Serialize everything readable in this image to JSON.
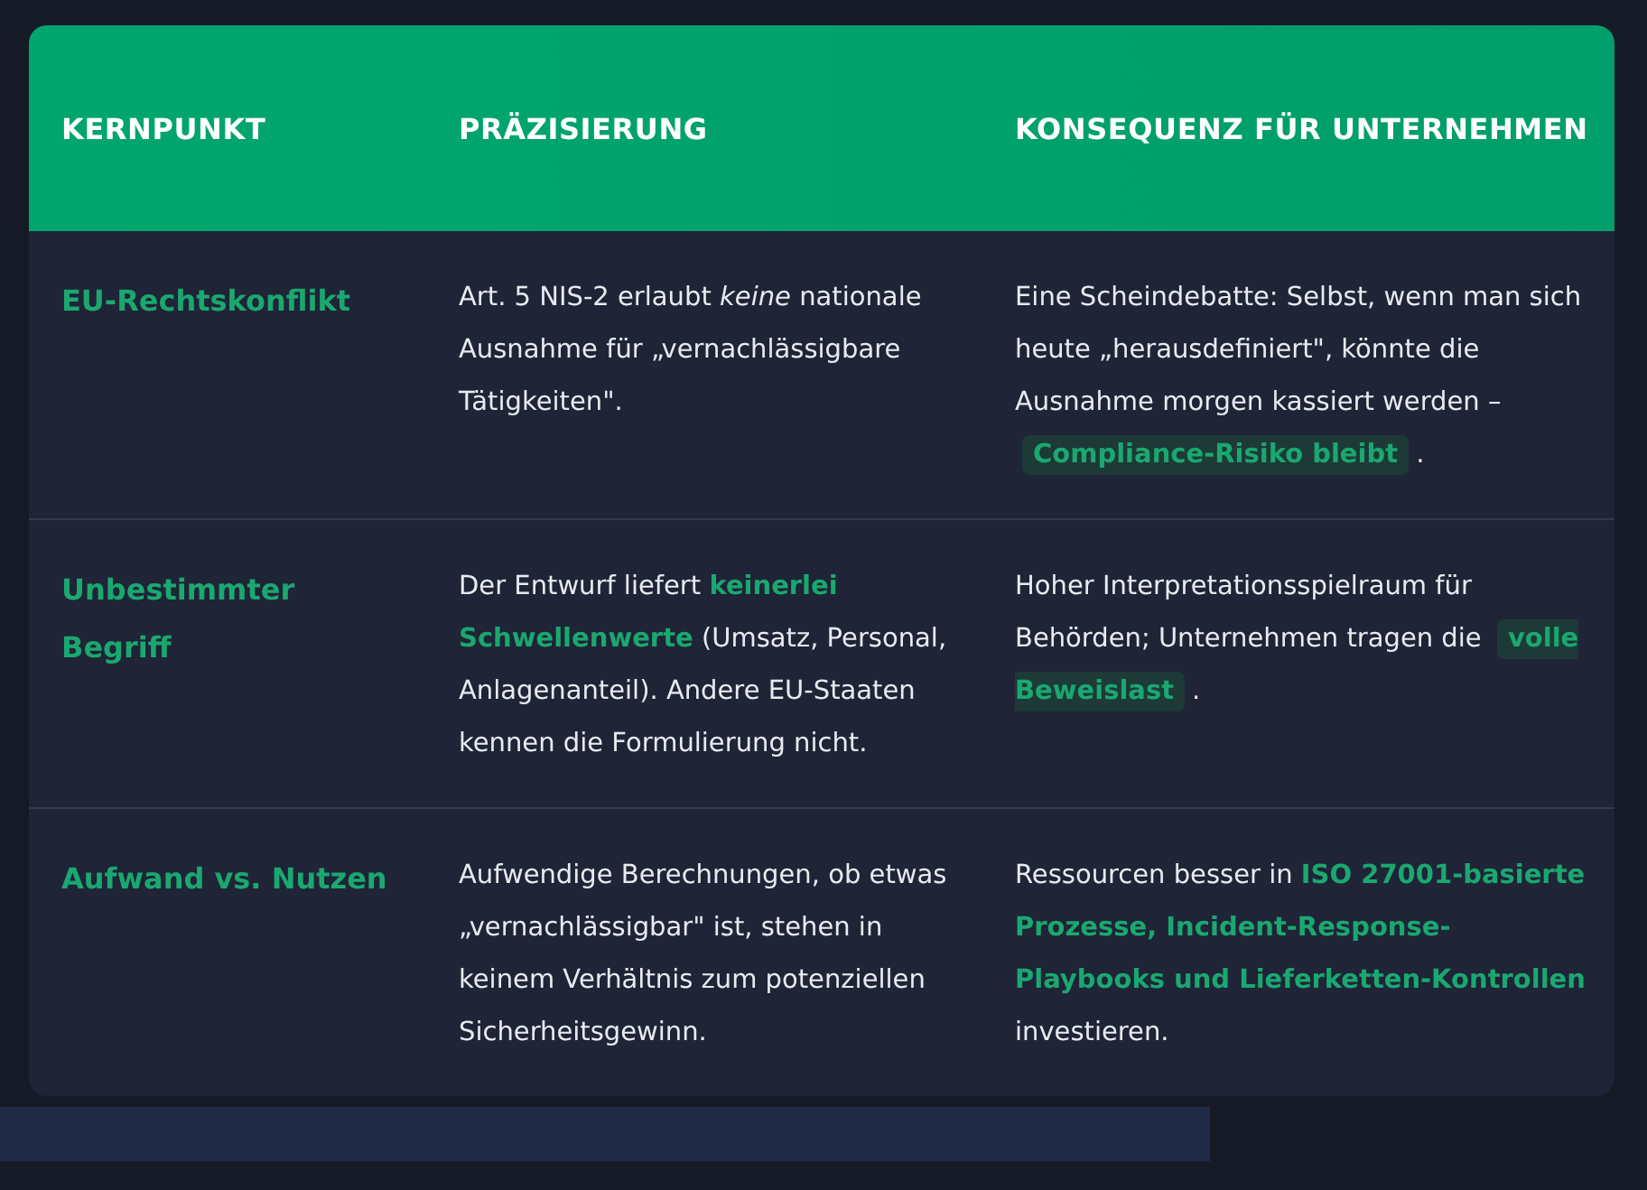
{
  "table": {
    "columns": [
      "KERNPUNKT",
      "PRÄZISIERUNG",
      "KONSEQUENZ FÜR UNTERNEHMEN"
    ],
    "rows": [
      {
        "key": "EU-Rechtskonflikt",
        "detail": [
          {
            "kind": "plain",
            "text": "Art. 5 NIS-2 erlaubt "
          },
          {
            "kind": "em",
            "text": "keine"
          },
          {
            "kind": "plain",
            "text": " nationale Ausnahme für „vernachlässigbare Tätigkeiten\"."
          }
        ],
        "consequence": [
          {
            "kind": "plain",
            "text": "Eine Scheindebatte: Selbst, wenn man sich heute „herausdefiniert\", könnte die Ausnahme morgen kassiert werden – "
          },
          {
            "kind": "chip",
            "text": "Compliance-Risiko bleibt"
          },
          {
            "kind": "plain",
            "text": "."
          }
        ]
      },
      {
        "key": "Unbestimmter Begriff",
        "detail": [
          {
            "kind": "plain",
            "text": "Der Entwurf liefert "
          },
          {
            "kind": "highlight",
            "text": "keinerlei Schwellenwerte"
          },
          {
            "kind": "plain",
            "text": " (Umsatz, Personal, Anlagenanteil). Andere EU-Staaten kennen die Formulierung nicht."
          }
        ],
        "consequence": [
          {
            "kind": "plain",
            "text": "Hoher Interpretationsspielraum für Behörden; Unternehmen tragen die "
          },
          {
            "kind": "chip",
            "text": "volle Beweislast"
          },
          {
            "kind": "plain",
            "text": "."
          }
        ]
      },
      {
        "key": "Aufwand vs. Nutzen",
        "detail": [
          {
            "kind": "plain",
            "text": "Aufwendige Berechnungen, ob etwas „vernachlässigbar\" ist, stehen in keinem Verhältnis zum potenziellen Sicherheitsgewinn."
          }
        ],
        "consequence": [
          {
            "kind": "plain",
            "text": "Ressourcen besser in "
          },
          {
            "kind": "highlight",
            "text": "ISO 27001-basierte Prozesse, Incident-Response-Playbooks und Lieferketten-Kontrollen"
          },
          {
            "kind": "plain",
            "text": " investieren."
          }
        ]
      }
    ]
  }
}
